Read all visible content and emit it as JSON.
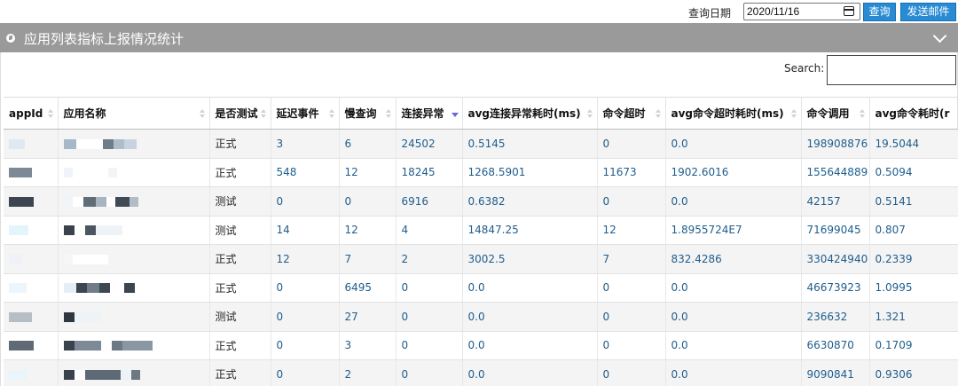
{
  "toolbar": {
    "date_label": "查询日期",
    "date_value": "2020/11/16",
    "query_label": "查询",
    "mail_label": "发送邮件"
  },
  "panel": {
    "title": "应用列表指标上报情况统计"
  },
  "search": {
    "label": "Search:",
    "value": ""
  },
  "table": {
    "columns": [
      "appId",
      "应用名称",
      "是否测试",
      "延迟事件",
      "慢查询",
      "连接异常",
      "avg连接异常耗时(ms)",
      "命令超时",
      "avg命令超时耗时(ms)",
      "命令调用",
      "avg命令耗时(r"
    ],
    "sorted_column": "连接异常",
    "rows": [
      {
        "test": "正式",
        "delay": "3",
        "slow": "6",
        "conn_err": "24502",
        "avg_conn": "0.5145",
        "cmd_timeout": "0",
        "avg_timeout": "0.0",
        "calls": "198908876",
        "avg_cmd": "19.5044"
      },
      {
        "test": "正式",
        "delay": "548",
        "slow": "12",
        "conn_err": "18245",
        "avg_conn": "1268.5901",
        "cmd_timeout": "11673",
        "avg_timeout": "1902.6016",
        "calls": "155644889",
        "avg_cmd": "0.5094"
      },
      {
        "test": "测试",
        "delay": "0",
        "slow": "0",
        "conn_err": "6916",
        "avg_conn": "0.6382",
        "cmd_timeout": "0",
        "avg_timeout": "0.0",
        "calls": "42157",
        "avg_cmd": "0.5141"
      },
      {
        "test": "测试",
        "delay": "14",
        "slow": "12",
        "conn_err": "4",
        "avg_conn": "14847.25",
        "cmd_timeout": "12",
        "avg_timeout": "1.8955724E7",
        "calls": "71699045",
        "avg_cmd": "0.807"
      },
      {
        "test": "正式",
        "delay": "12",
        "slow": "7",
        "conn_err": "2",
        "avg_conn": "3002.5",
        "cmd_timeout": "7",
        "avg_timeout": "832.4286",
        "calls": "330424940",
        "avg_cmd": "0.2339"
      },
      {
        "test": "正式",
        "delay": "0",
        "slow": "6495",
        "conn_err": "0",
        "avg_conn": "0.0",
        "cmd_timeout": "0",
        "avg_timeout": "0.0",
        "calls": "46673923",
        "avg_cmd": "1.0995"
      },
      {
        "test": "测试",
        "delay": "0",
        "slow": "27",
        "conn_err": "0",
        "avg_conn": "0.0",
        "cmd_timeout": "0",
        "avg_timeout": "0.0",
        "calls": "236632",
        "avg_cmd": "1.321"
      },
      {
        "test": "正式",
        "delay": "0",
        "slow": "3",
        "conn_err": "0",
        "avg_conn": "0.0",
        "cmd_timeout": "0",
        "avg_timeout": "0.0",
        "calls": "6630870",
        "avg_cmd": "0.1709"
      },
      {
        "test": "正式",
        "delay": "0",
        "slow": "2",
        "conn_err": "0",
        "avg_conn": "0.0",
        "cmd_timeout": "0",
        "avg_timeout": "0.0",
        "calls": "9090841",
        "avg_cmd": "0.9306"
      }
    ]
  },
  "colors": {
    "header_bg": "#9a9a9a",
    "button_bg": "#2a8bd5",
    "link_text": "#1f5d8c",
    "sort_active": "#6a6ad0"
  }
}
